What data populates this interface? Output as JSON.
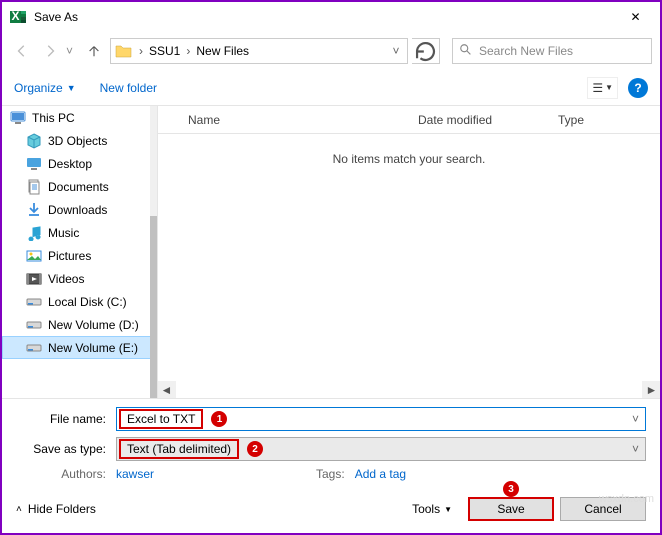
{
  "title": "Save As",
  "breadcrumb": {
    "item1": "SSU1",
    "item2": "New Files"
  },
  "search": {
    "placeholder": "Search New Files"
  },
  "toolbar": {
    "organize": "Organize",
    "newfolder": "New folder",
    "help": "?"
  },
  "columns": {
    "name": "Name",
    "date": "Date modified",
    "type": "Type"
  },
  "empty_msg": "No items match your search.",
  "nav": {
    "thispc": "This PC",
    "items": [
      {
        "label": "3D Objects",
        "icon": "cube"
      },
      {
        "label": "Desktop",
        "icon": "desktop"
      },
      {
        "label": "Documents",
        "icon": "doc"
      },
      {
        "label": "Downloads",
        "icon": "download"
      },
      {
        "label": "Music",
        "icon": "music"
      },
      {
        "label": "Pictures",
        "icon": "picture"
      },
      {
        "label": "Videos",
        "icon": "video"
      },
      {
        "label": "Local Disk (C:)",
        "icon": "disk"
      },
      {
        "label": "New Volume (D:)",
        "icon": "disk"
      },
      {
        "label": "New Volume (E:)",
        "icon": "disk"
      }
    ]
  },
  "filename": {
    "label": "File name:",
    "value": "Excel to TXT",
    "badge": "1"
  },
  "savetype": {
    "label": "Save as type:",
    "value": "Text (Tab delimited)",
    "badge": "2"
  },
  "authors": {
    "label": "Authors:",
    "value": "kawser"
  },
  "tags": {
    "label": "Tags:",
    "value": "Add a tag"
  },
  "footer": {
    "hidefolders": "Hide Folders",
    "tools": "Tools",
    "save": "Save",
    "cancel": "Cancel",
    "save_badge": "3"
  },
  "watermark": "wsxdn.com"
}
